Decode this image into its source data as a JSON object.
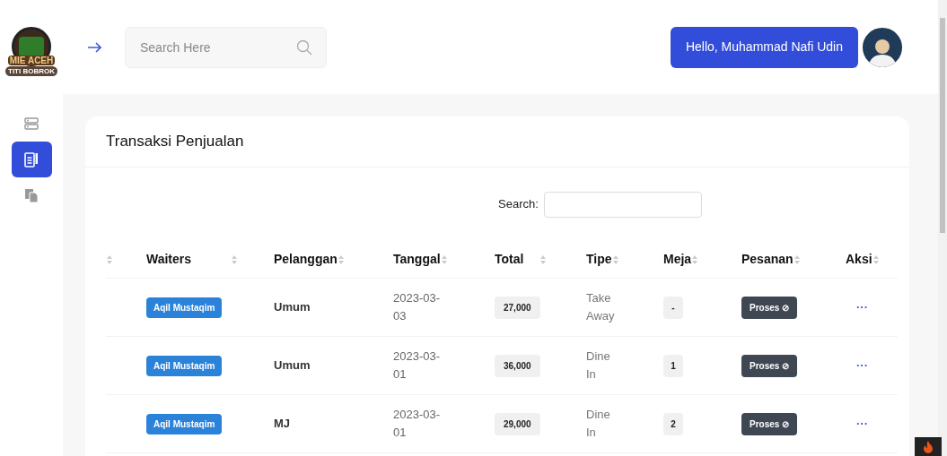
{
  "logo": {
    "line_1": "MIE ACEH",
    "line_2": "TITI BOBROK"
  },
  "header": {
    "search": {
      "placeholder": "Search Here"
    },
    "greeting": "Hello, Muhammad Nafi Udin"
  },
  "sidebar": {
    "items": [
      {
        "selected": false
      },
      {
        "selected": true
      },
      {
        "selected": false
      }
    ]
  },
  "card": {
    "title": "Transaksi Penjualan",
    "search_label": "Search:"
  },
  "table": {
    "columns": [
      "Waiters",
      "Pelanggan",
      "Tanggal",
      "Total",
      "Tipe",
      "Meja",
      "Pesanan",
      "Aksi"
    ],
    "rows": [
      {
        "waiter": "Aqil Mustaqim",
        "customer": "Umum",
        "date": "2023-03-03",
        "total": "27,000",
        "type": "Take Away",
        "table": "-",
        "status": "Proses ⊘",
        "action": "···"
      },
      {
        "waiter": "Aqil Mustaqim",
        "customer": "Umum",
        "date": "2023-03-01",
        "total": "36,000",
        "type": "Dine In",
        "table": "1",
        "status": "Proses ⊘",
        "action": "···"
      },
      {
        "waiter": "Aqil Mustaqim",
        "customer": "MJ",
        "date": "2023-03-01",
        "total": "29,000",
        "type": "Dine In",
        "table": "2",
        "status": "Proses ⊘",
        "action": "···"
      }
    ]
  }
}
